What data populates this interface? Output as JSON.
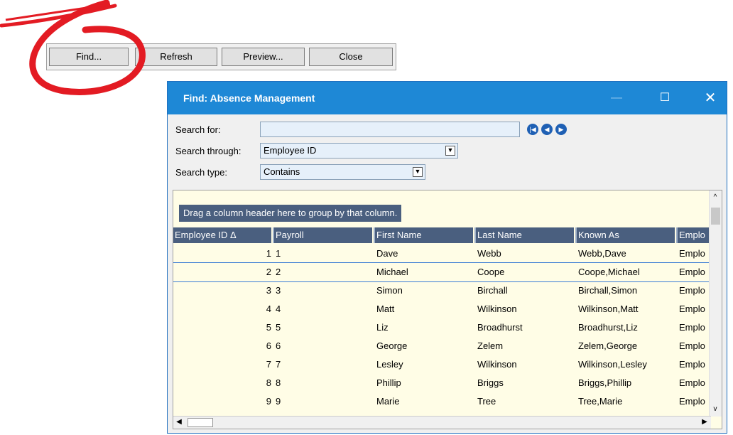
{
  "toolbar": {
    "find": "Find...",
    "refresh": "Refresh",
    "preview": "Preview...",
    "close": "Close"
  },
  "dialog": {
    "title": "Find: Absence Management",
    "minimize": "—",
    "maximize": "☐",
    "close": "✕",
    "search_for_label": "Search for:",
    "search_for_value": "",
    "search_through_label": "Search through:",
    "search_through_value": "Employee ID",
    "search_type_label": "Search type:",
    "search_type_value": "Contains"
  },
  "grid": {
    "group_hint": "Drag a column header here to group by that column.",
    "columns": [
      "Employee ID Δ",
      "Payroll",
      "First Name",
      "Last Name",
      "Known As",
      "Emplo"
    ],
    "rows": [
      [
        "1",
        "1",
        "Dave",
        "Webb",
        "Webb,Dave",
        "Emplo"
      ],
      [
        "2",
        "2",
        "Michael",
        "Coope",
        "Coope,Michael",
        "Emplo"
      ],
      [
        "3",
        "3",
        "Simon",
        "Birchall",
        "Birchall,Simon",
        "Emplo"
      ],
      [
        "4",
        "4",
        "Matt",
        "Wilkinson",
        "Wilkinson,Matt",
        "Emplo"
      ],
      [
        "5",
        "5",
        "Liz",
        "Broadhurst",
        "Broadhurst,Liz",
        "Emplo"
      ],
      [
        "6",
        "6",
        "George",
        "Zelem",
        "Zelem,George",
        "Emplo"
      ],
      [
        "7",
        "7",
        "Lesley",
        "Wilkinson",
        "Wilkinson,Lesley",
        "Emplo"
      ],
      [
        "8",
        "8",
        "Phillip",
        "Briggs",
        "Briggs,Phillip",
        "Emplo"
      ],
      [
        "9",
        "9",
        "Marie",
        "Tree",
        "Tree,Marie",
        "Emplo"
      ]
    ],
    "selected_row": 2
  },
  "colors": {
    "titlebar": "#1e88d6",
    "header": "#4a5f7f",
    "grid_bg": "#fffde6",
    "annotation": "#e31b23"
  }
}
